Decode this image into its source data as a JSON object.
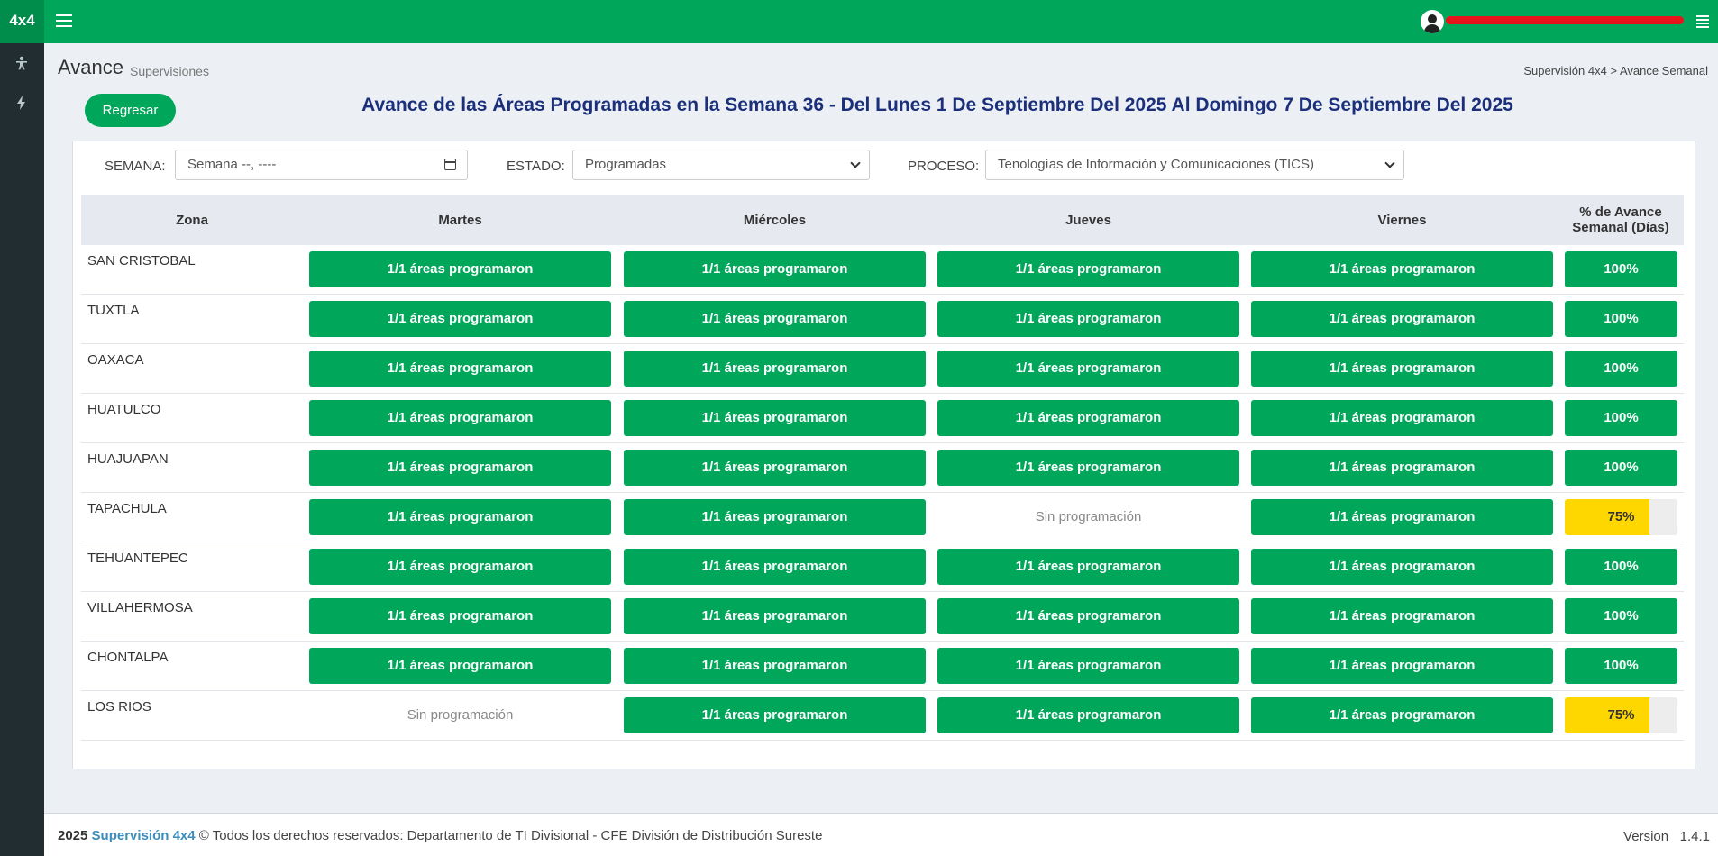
{
  "app": {
    "logo": "4x4",
    "user_name": "",
    "colors": {
      "primary": "#00a65a",
      "sidebar": "#222d32",
      "warning": "#ffd700",
      "heading": "#1b2f7a"
    }
  },
  "sidebar": {
    "icons": [
      "person-icon",
      "bolt-icon"
    ]
  },
  "header": {
    "title": "Avance",
    "subtitle": "Supervisiones",
    "breadcrumb": "Supervisión 4x4 > Avance Semanal"
  },
  "main": {
    "back_button": "Regresar",
    "heading": "Avance de las Áreas Programadas en la Semana 36 - Del Lunes 1 De Septiembre Del 2025 Al Domingo 7 De Septiembre Del 2025"
  },
  "filters": {
    "semana_label": "SEMANA:",
    "semana_value": "Semana --, ----",
    "estado_label": "ESTADO:",
    "estado_value": "Programadas",
    "proceso_label": "PROCESO:",
    "proceso_value": "Tenologías de Información y Comunicaciones (TICS)"
  },
  "table": {
    "headers": [
      "Zona",
      "Martes",
      "Miércoles",
      "Jueves",
      "Viernes",
      "% de Avance Semanal (Días)"
    ],
    "rows": [
      {
        "zona": "SAN CRISTOBAL",
        "cells": [
          "1/1 áreas programaron",
          "1/1 áreas programaron",
          "1/1 áreas programaron",
          "1/1 áreas programaron"
        ],
        "pct": "100%",
        "pct_value": 100
      },
      {
        "zona": "TUXTLA",
        "cells": [
          "1/1 áreas programaron",
          "1/1 áreas programaron",
          "1/1 áreas programaron",
          "1/1 áreas programaron"
        ],
        "pct": "100%",
        "pct_value": 100
      },
      {
        "zona": "OAXACA",
        "cells": [
          "1/1 áreas programaron",
          "1/1 áreas programaron",
          "1/1 áreas programaron",
          "1/1 áreas programaron"
        ],
        "pct": "100%",
        "pct_value": 100
      },
      {
        "zona": "HUATULCO",
        "cells": [
          "1/1 áreas programaron",
          "1/1 áreas programaron",
          "1/1 áreas programaron",
          "1/1 áreas programaron"
        ],
        "pct": "100%",
        "pct_value": 100
      },
      {
        "zona": "HUAJUAPAN",
        "cells": [
          "1/1 áreas programaron",
          "1/1 áreas programaron",
          "1/1 áreas programaron",
          "1/1 áreas programaron"
        ],
        "pct": "100%",
        "pct_value": 100
      },
      {
        "zona": "TAPACHULA",
        "cells": [
          "1/1 áreas programaron",
          "1/1 áreas programaron",
          "Sin programación",
          "1/1 áreas programaron"
        ],
        "pct": "75%",
        "pct_value": 75
      },
      {
        "zona": "TEHUANTEPEC",
        "cells": [
          "1/1 áreas programaron",
          "1/1 áreas programaron",
          "1/1 áreas programaron",
          "1/1 áreas programaron"
        ],
        "pct": "100%",
        "pct_value": 100
      },
      {
        "zona": "VILLAHERMOSA",
        "cells": [
          "1/1 áreas programaron",
          "1/1 áreas programaron",
          "1/1 áreas programaron",
          "1/1 áreas programaron"
        ],
        "pct": "100%",
        "pct_value": 100
      },
      {
        "zona": "CHONTALPA",
        "cells": [
          "1/1 áreas programaron",
          "1/1 áreas programaron",
          "1/1 áreas programaron",
          "1/1 áreas programaron"
        ],
        "pct": "100%",
        "pct_value": 100
      },
      {
        "zona": "LOS RIOS",
        "cells": [
          "Sin programación",
          "1/1 áreas programaron",
          "1/1 áreas programaron",
          "1/1 áreas programaron"
        ],
        "pct": "75%",
        "pct_value": 75
      }
    ]
  },
  "footer": {
    "year": "2025",
    "brand": "Supervisión 4x4",
    "rights": "© Todos los derechos reservados: Departamento de TI Divisional - CFE División de Distribución Sureste",
    "version_label": "Version",
    "version": "1.4.1"
  }
}
